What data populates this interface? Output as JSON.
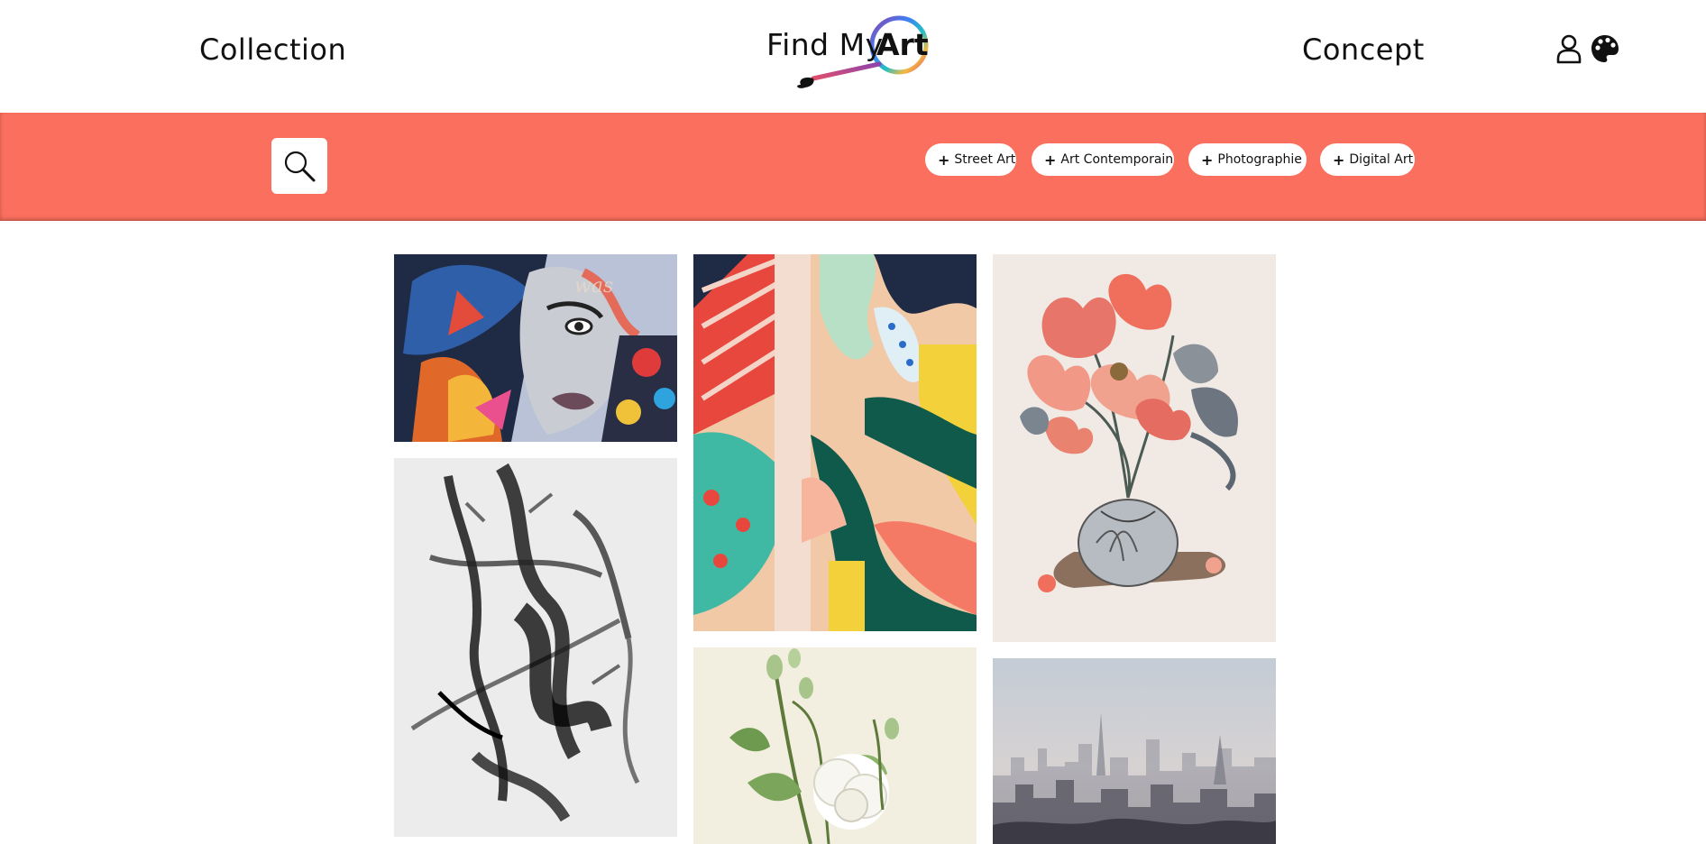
{
  "header": {
    "nav_left": "Collection",
    "nav_right": "Concept",
    "logo": {
      "text": "Find My",
      "highlight": "Art"
    },
    "icons": [
      "user-icon",
      "palette-icon"
    ]
  },
  "filter_bar": {
    "background": "#fb6f5e",
    "search_icon": "search-icon",
    "tags": [
      {
        "plus": "+",
        "label": "Street Art"
      },
      {
        "plus": "+",
        "label": "Art Contemporain"
      },
      {
        "plus": "+",
        "label": "Photographie"
      },
      {
        "plus": "+",
        "label": "Digital Art"
      }
    ]
  },
  "gallery": {
    "items": [
      {
        "name": "street-art-portrait-mural"
      },
      {
        "name": "abstract-ink-brushstrokes"
      },
      {
        "name": "colorful-abstract-mural"
      },
      {
        "name": "white-rose-botanical-print"
      },
      {
        "name": "flower-vase-still-life-print"
      },
      {
        "name": "foggy-city-skyline-photo"
      }
    ]
  }
}
